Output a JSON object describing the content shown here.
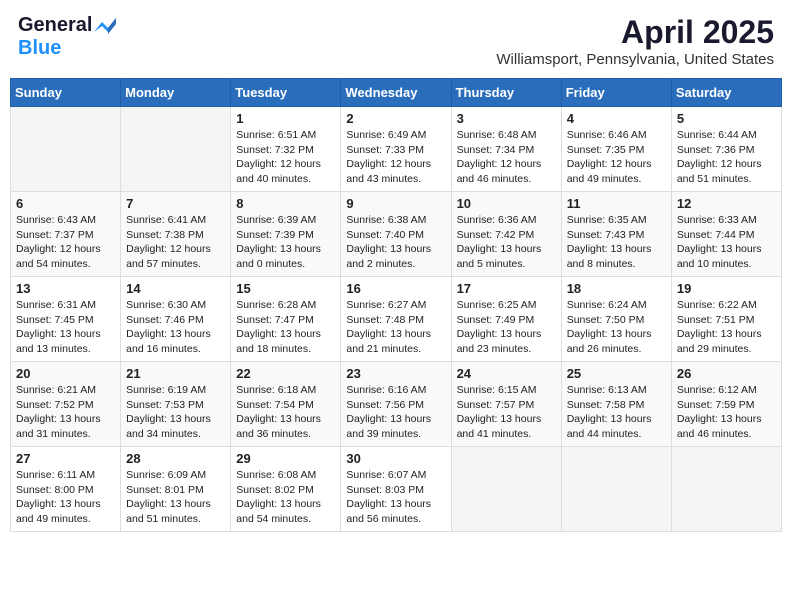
{
  "header": {
    "logo_general": "General",
    "logo_blue": "Blue",
    "month": "April 2025",
    "location": "Williamsport, Pennsylvania, United States"
  },
  "days_of_week": [
    "Sunday",
    "Monday",
    "Tuesday",
    "Wednesday",
    "Thursday",
    "Friday",
    "Saturday"
  ],
  "weeks": [
    [
      {
        "day": "",
        "info": ""
      },
      {
        "day": "",
        "info": ""
      },
      {
        "day": "1",
        "info": "Sunrise: 6:51 AM\nSunset: 7:32 PM\nDaylight: 12 hours and 40 minutes."
      },
      {
        "day": "2",
        "info": "Sunrise: 6:49 AM\nSunset: 7:33 PM\nDaylight: 12 hours and 43 minutes."
      },
      {
        "day": "3",
        "info": "Sunrise: 6:48 AM\nSunset: 7:34 PM\nDaylight: 12 hours and 46 minutes."
      },
      {
        "day": "4",
        "info": "Sunrise: 6:46 AM\nSunset: 7:35 PM\nDaylight: 12 hours and 49 minutes."
      },
      {
        "day": "5",
        "info": "Sunrise: 6:44 AM\nSunset: 7:36 PM\nDaylight: 12 hours and 51 minutes."
      }
    ],
    [
      {
        "day": "6",
        "info": "Sunrise: 6:43 AM\nSunset: 7:37 PM\nDaylight: 12 hours and 54 minutes."
      },
      {
        "day": "7",
        "info": "Sunrise: 6:41 AM\nSunset: 7:38 PM\nDaylight: 12 hours and 57 minutes."
      },
      {
        "day": "8",
        "info": "Sunrise: 6:39 AM\nSunset: 7:39 PM\nDaylight: 13 hours and 0 minutes."
      },
      {
        "day": "9",
        "info": "Sunrise: 6:38 AM\nSunset: 7:40 PM\nDaylight: 13 hours and 2 minutes."
      },
      {
        "day": "10",
        "info": "Sunrise: 6:36 AM\nSunset: 7:42 PM\nDaylight: 13 hours and 5 minutes."
      },
      {
        "day": "11",
        "info": "Sunrise: 6:35 AM\nSunset: 7:43 PM\nDaylight: 13 hours and 8 minutes."
      },
      {
        "day": "12",
        "info": "Sunrise: 6:33 AM\nSunset: 7:44 PM\nDaylight: 13 hours and 10 minutes."
      }
    ],
    [
      {
        "day": "13",
        "info": "Sunrise: 6:31 AM\nSunset: 7:45 PM\nDaylight: 13 hours and 13 minutes."
      },
      {
        "day": "14",
        "info": "Sunrise: 6:30 AM\nSunset: 7:46 PM\nDaylight: 13 hours and 16 minutes."
      },
      {
        "day": "15",
        "info": "Sunrise: 6:28 AM\nSunset: 7:47 PM\nDaylight: 13 hours and 18 minutes."
      },
      {
        "day": "16",
        "info": "Sunrise: 6:27 AM\nSunset: 7:48 PM\nDaylight: 13 hours and 21 minutes."
      },
      {
        "day": "17",
        "info": "Sunrise: 6:25 AM\nSunset: 7:49 PM\nDaylight: 13 hours and 23 minutes."
      },
      {
        "day": "18",
        "info": "Sunrise: 6:24 AM\nSunset: 7:50 PM\nDaylight: 13 hours and 26 minutes."
      },
      {
        "day": "19",
        "info": "Sunrise: 6:22 AM\nSunset: 7:51 PM\nDaylight: 13 hours and 29 minutes."
      }
    ],
    [
      {
        "day": "20",
        "info": "Sunrise: 6:21 AM\nSunset: 7:52 PM\nDaylight: 13 hours and 31 minutes."
      },
      {
        "day": "21",
        "info": "Sunrise: 6:19 AM\nSunset: 7:53 PM\nDaylight: 13 hours and 34 minutes."
      },
      {
        "day": "22",
        "info": "Sunrise: 6:18 AM\nSunset: 7:54 PM\nDaylight: 13 hours and 36 minutes."
      },
      {
        "day": "23",
        "info": "Sunrise: 6:16 AM\nSunset: 7:56 PM\nDaylight: 13 hours and 39 minutes."
      },
      {
        "day": "24",
        "info": "Sunrise: 6:15 AM\nSunset: 7:57 PM\nDaylight: 13 hours and 41 minutes."
      },
      {
        "day": "25",
        "info": "Sunrise: 6:13 AM\nSunset: 7:58 PM\nDaylight: 13 hours and 44 minutes."
      },
      {
        "day": "26",
        "info": "Sunrise: 6:12 AM\nSunset: 7:59 PM\nDaylight: 13 hours and 46 minutes."
      }
    ],
    [
      {
        "day": "27",
        "info": "Sunrise: 6:11 AM\nSunset: 8:00 PM\nDaylight: 13 hours and 49 minutes."
      },
      {
        "day": "28",
        "info": "Sunrise: 6:09 AM\nSunset: 8:01 PM\nDaylight: 13 hours and 51 minutes."
      },
      {
        "day": "29",
        "info": "Sunrise: 6:08 AM\nSunset: 8:02 PM\nDaylight: 13 hours and 54 minutes."
      },
      {
        "day": "30",
        "info": "Sunrise: 6:07 AM\nSunset: 8:03 PM\nDaylight: 13 hours and 56 minutes."
      },
      {
        "day": "",
        "info": ""
      },
      {
        "day": "",
        "info": ""
      },
      {
        "day": "",
        "info": ""
      }
    ]
  ]
}
